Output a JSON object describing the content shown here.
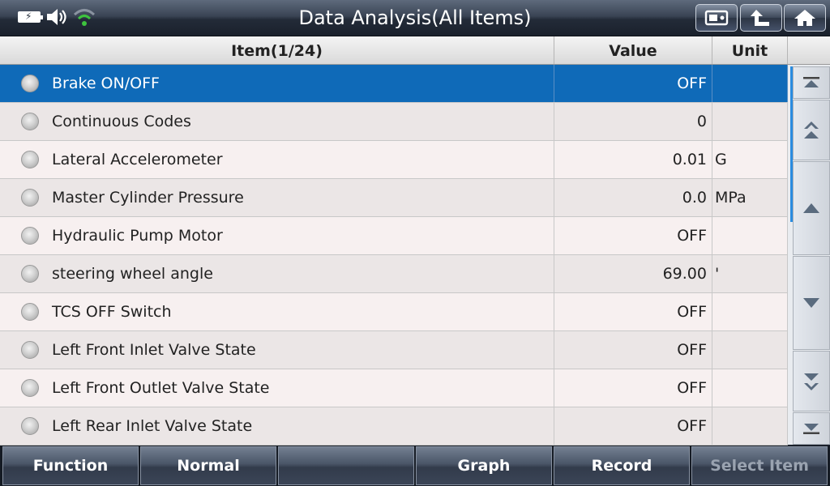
{
  "header": {
    "title": "Data Analysis(All Items)",
    "battery_symbol": "⚡",
    "buttons": [
      "screenshot-icon",
      "back-arrow-icon",
      "home-icon"
    ]
  },
  "table": {
    "col_item": "Item(1/24)",
    "col_value": "Value",
    "col_unit": "Unit",
    "rows": [
      {
        "name": "Brake ON/OFF",
        "value": "OFF",
        "unit": ""
      },
      {
        "name": "Continuous Codes",
        "value": "0",
        "unit": ""
      },
      {
        "name": "Lateral Accelerometer",
        "value": "0.01",
        "unit": "G"
      },
      {
        "name": "Master Cylinder Pressure",
        "value": "0.0",
        "unit": "MPa"
      },
      {
        "name": "Hydraulic Pump Motor",
        "value": "OFF",
        "unit": ""
      },
      {
        "name": "steering wheel angle",
        "value": "69.00",
        "unit": "'"
      },
      {
        "name": "TCS OFF Switch",
        "value": "OFF",
        "unit": ""
      },
      {
        "name": "Left Front Inlet Valve State",
        "value": "OFF",
        "unit": ""
      },
      {
        "name": "Left Front Outlet Valve State",
        "value": "OFF",
        "unit": ""
      },
      {
        "name": "Left Rear Inlet Valve State",
        "value": "OFF",
        "unit": ""
      }
    ],
    "selected_index": 0
  },
  "bottombar": {
    "function": "Function",
    "normal": "Normal",
    "empty": "",
    "graph": "Graph",
    "record": "Record",
    "select_item": "Select Item"
  },
  "colors": {
    "selected_row": "#0f6ab8",
    "wifi": "#3ec33e"
  }
}
